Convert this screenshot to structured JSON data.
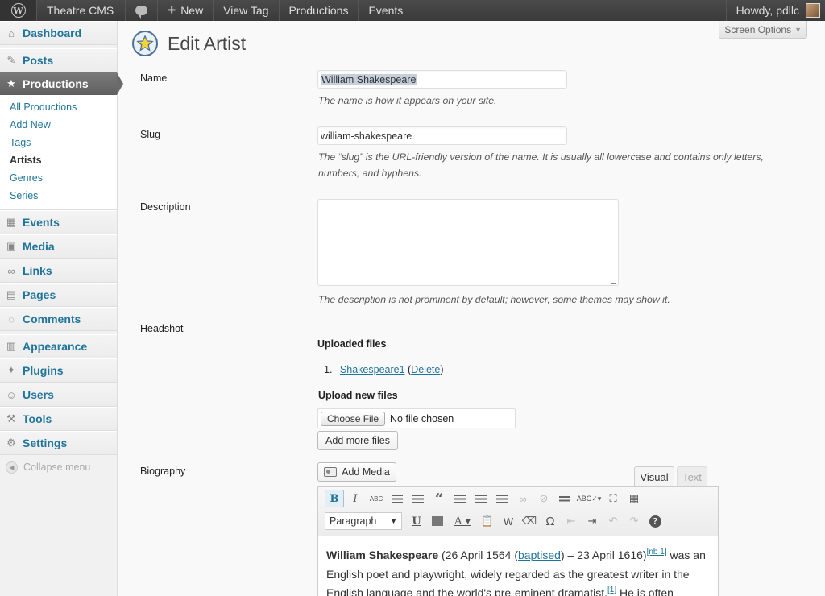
{
  "adminbar": {
    "site_name": "Theatre CMS",
    "new_label": "New",
    "view_tag_label": "View Tag",
    "productions_label": "Productions",
    "events_label": "Events",
    "howdy": "Howdy, pdllc"
  },
  "sidebar": {
    "dashboard": "Dashboard",
    "posts": "Posts",
    "productions": "Productions",
    "submenu": [
      "All Productions",
      "Add New",
      "Tags",
      "Artists",
      "Genres",
      "Series"
    ],
    "events": "Events",
    "media": "Media",
    "links": "Links",
    "pages": "Pages",
    "comments": "Comments",
    "appearance": "Appearance",
    "plugins": "Plugins",
    "users": "Users",
    "tools": "Tools",
    "settings": "Settings",
    "collapse": "Collapse menu"
  },
  "page": {
    "screen_options": "Screen Options",
    "title": "Edit Artist"
  },
  "form": {
    "name_label": "Name",
    "name_value": "William Shakespeare",
    "name_desc": "The name is how it appears on your site.",
    "slug_label": "Slug",
    "slug_value": "william-shakespeare",
    "slug_desc_1": "The “slug” is the URL-friendly version of the name. It is usually all lowercase and contains only letters,",
    "slug_desc_2": "numbers, and hyphens.",
    "description_label": "Description",
    "description_desc": "The description is not prominent by default; however, some themes may show it.",
    "headshot_label": "Headshot",
    "uploaded_files": "Uploaded files",
    "file_number": "1.",
    "file_name": "Shakespeare1",
    "delete_label": "Delete",
    "upload_new": "Upload new files",
    "choose_file": "Choose File",
    "no_file": "No file chosen",
    "add_more": "Add more files",
    "biography_label": "Biography",
    "add_media": "Add Media",
    "tab_visual": "Visual",
    "tab_text": "Text",
    "format_select": "Paragraph"
  },
  "biography": {
    "name": "William Shakespeare",
    "t1": " (26 April 1564 (",
    "baptised": "baptised",
    "t2": ") – 23 April 1616)",
    "ref1": "[nb 1]",
    "t3": " was an English poet and playwright, widely regarded as the greatest writer in the English language and the world's pre-eminent dramatist.",
    "ref2": "[1]",
    "t4": " He is often"
  }
}
